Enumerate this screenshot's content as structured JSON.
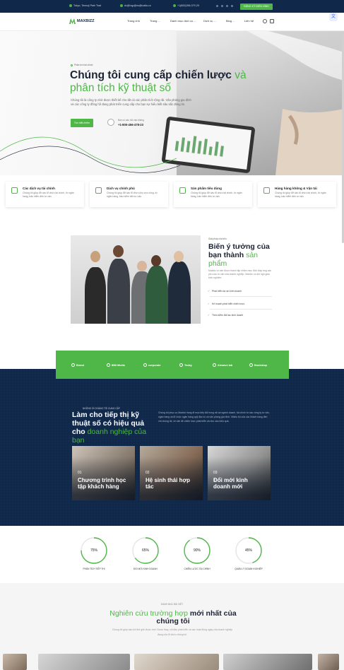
{
  "topbar": {
    "address": "Tokyo, Tennoji Park Trad",
    "email": "dv@hqp@ns@ioalla.co",
    "phone": "+1(800)266-379-25",
    "button": "ĐĂNG KÝ ĐIỂN HÌNH"
  },
  "nav": {
    "logo": "MAXBIZZ",
    "items": [
      "Trang chủ",
      "Trang ...",
      "Danh mục dịch vụ ...",
      "Dịch vụ ...",
      "Blog ...",
      "Liên hệ"
    ]
  },
  "hero": {
    "tag": "Phân tích tài chính",
    "title_dark": "Chúng tôi cung cấp chiến lược",
    "title_green": "và phân tích kỹ thuật số",
    "desc": "Chúng tôi là công ty nhờ được thiết kế cho tất cả các phân tích rộng rãi. Văn phòng gia đình và các công ty đồng hồ đang phát triển cung cấp cho bạn sự hiểu biết sâu sắc đáng tin.",
    "cta": "Tìm hiểu thêm",
    "phone_label": "Bạn có câu hỏi nào không",
    "phone_number": "+1-800-456-478-23"
  },
  "features": [
    {
      "title": "Các dịch vụ tài chính",
      "desc": "Chúng tôi giúp đỡ các tổ chức tài chính, từ ngân hàng, bảo hiểm đến tư vấn."
    },
    {
      "title": "Dịch vụ chính phủ",
      "desc": "Chúng tôi giúp đỡ các tổ chức khu vực công, từ ngân hàng, bảo hiểm đến tư vấn."
    },
    {
      "title": "Sản phẩm tiêu dùng",
      "desc": "Chúng tôi giúp đỡ các tổ chức tài chính, từ ngân hàng, bảo hiểm đến tư vấn."
    },
    {
      "title": "Hàng hàng không & Vận tải",
      "desc": "Chúng tôi giúp đỡ các tổ chức tài chính, từ ngân hàng, bảo hiểm đến tư vấn."
    }
  ],
  "about": {
    "tag": "Giải pháp của tiếu",
    "title_dark": "Biến ý tưởng của bạn thành",
    "title_green": "sản phẩm",
    "desc": "Maxbiz tư vấn được thành lập nhằm mục đích đáp ứng các yêu cầu tư vấn của doanh nghiệp. Maxbiz có đội ngũ giàu kinh nghiệm.",
    "points": [
      "Phát triển dự án kinh doanh",
      "Kế hoạch phát triển chiến lược",
      "Theo kiểm đối tác kinh doanh"
    ]
  },
  "partners": [
    "Brand",
    "IBM Media",
    "corporate",
    "Today",
    "Airwave lab",
    "Bootstrap"
  ],
  "services": {
    "tag": "NHỮNG GÌ CHÚNG TÔI CUNG CẤP",
    "title_dark": "Làm cho tiếp thị kỹ thuật số có hiệu quả cho",
    "title_green": "doanh nghiệp của bạn",
    "desc": "Chúng tôi phục vụ Maxbiz hàng đi mục tiếp đối trong rất cả ngành doanh, tài chính từ các công ty tư vấn, ngân hàng và tổ chức ngân hàng quỹ đầu tư và văn phòng gia đình. Nhiều bộ của các khách hàng đến với chúng tôi, về vấn đề chiến lược phát triển và nhu cầu hiệu quả.",
    "items": [
      {
        "num": "01",
        "title": "Chương trình học tập khách hàng"
      },
      {
        "num": "02",
        "title": "Hệ sinh thái hợp tác"
      },
      {
        "num": "03",
        "title": "Đổi mới kinh doanh mới"
      }
    ]
  },
  "stats": [
    {
      "value": "75%",
      "label": "PHÂN TÍCH TIẾP THỊ",
      "pct": 75
    },
    {
      "value": "65%",
      "label": "ĐỔI MỚI KINH DOANH",
      "pct": 65
    },
    {
      "value": "90%",
      "label": "CHIẾN LƯỢC TÀI CHÍNH",
      "pct": 90
    },
    {
      "value": "45%",
      "label": "QUẢN LÝ DOANH NGHIỆP",
      "pct": 45
    }
  ],
  "blog": {
    "tag": "DANH MỤC BÀI VIẾT",
    "title_green": "Nghiên cứu trường hợp",
    "title_dark": "mới nhất của chúng tôi",
    "desc": "Chúng tôi giúp bạn khi thế giới được mới. Được thay, chỉ đầu phát triển và các hoạt động ngày của doanh nghiệp đang của tổ chức chúng tôi."
  },
  "colors": {
    "accent": "#4fb748",
    "navy": "#10284a"
  }
}
